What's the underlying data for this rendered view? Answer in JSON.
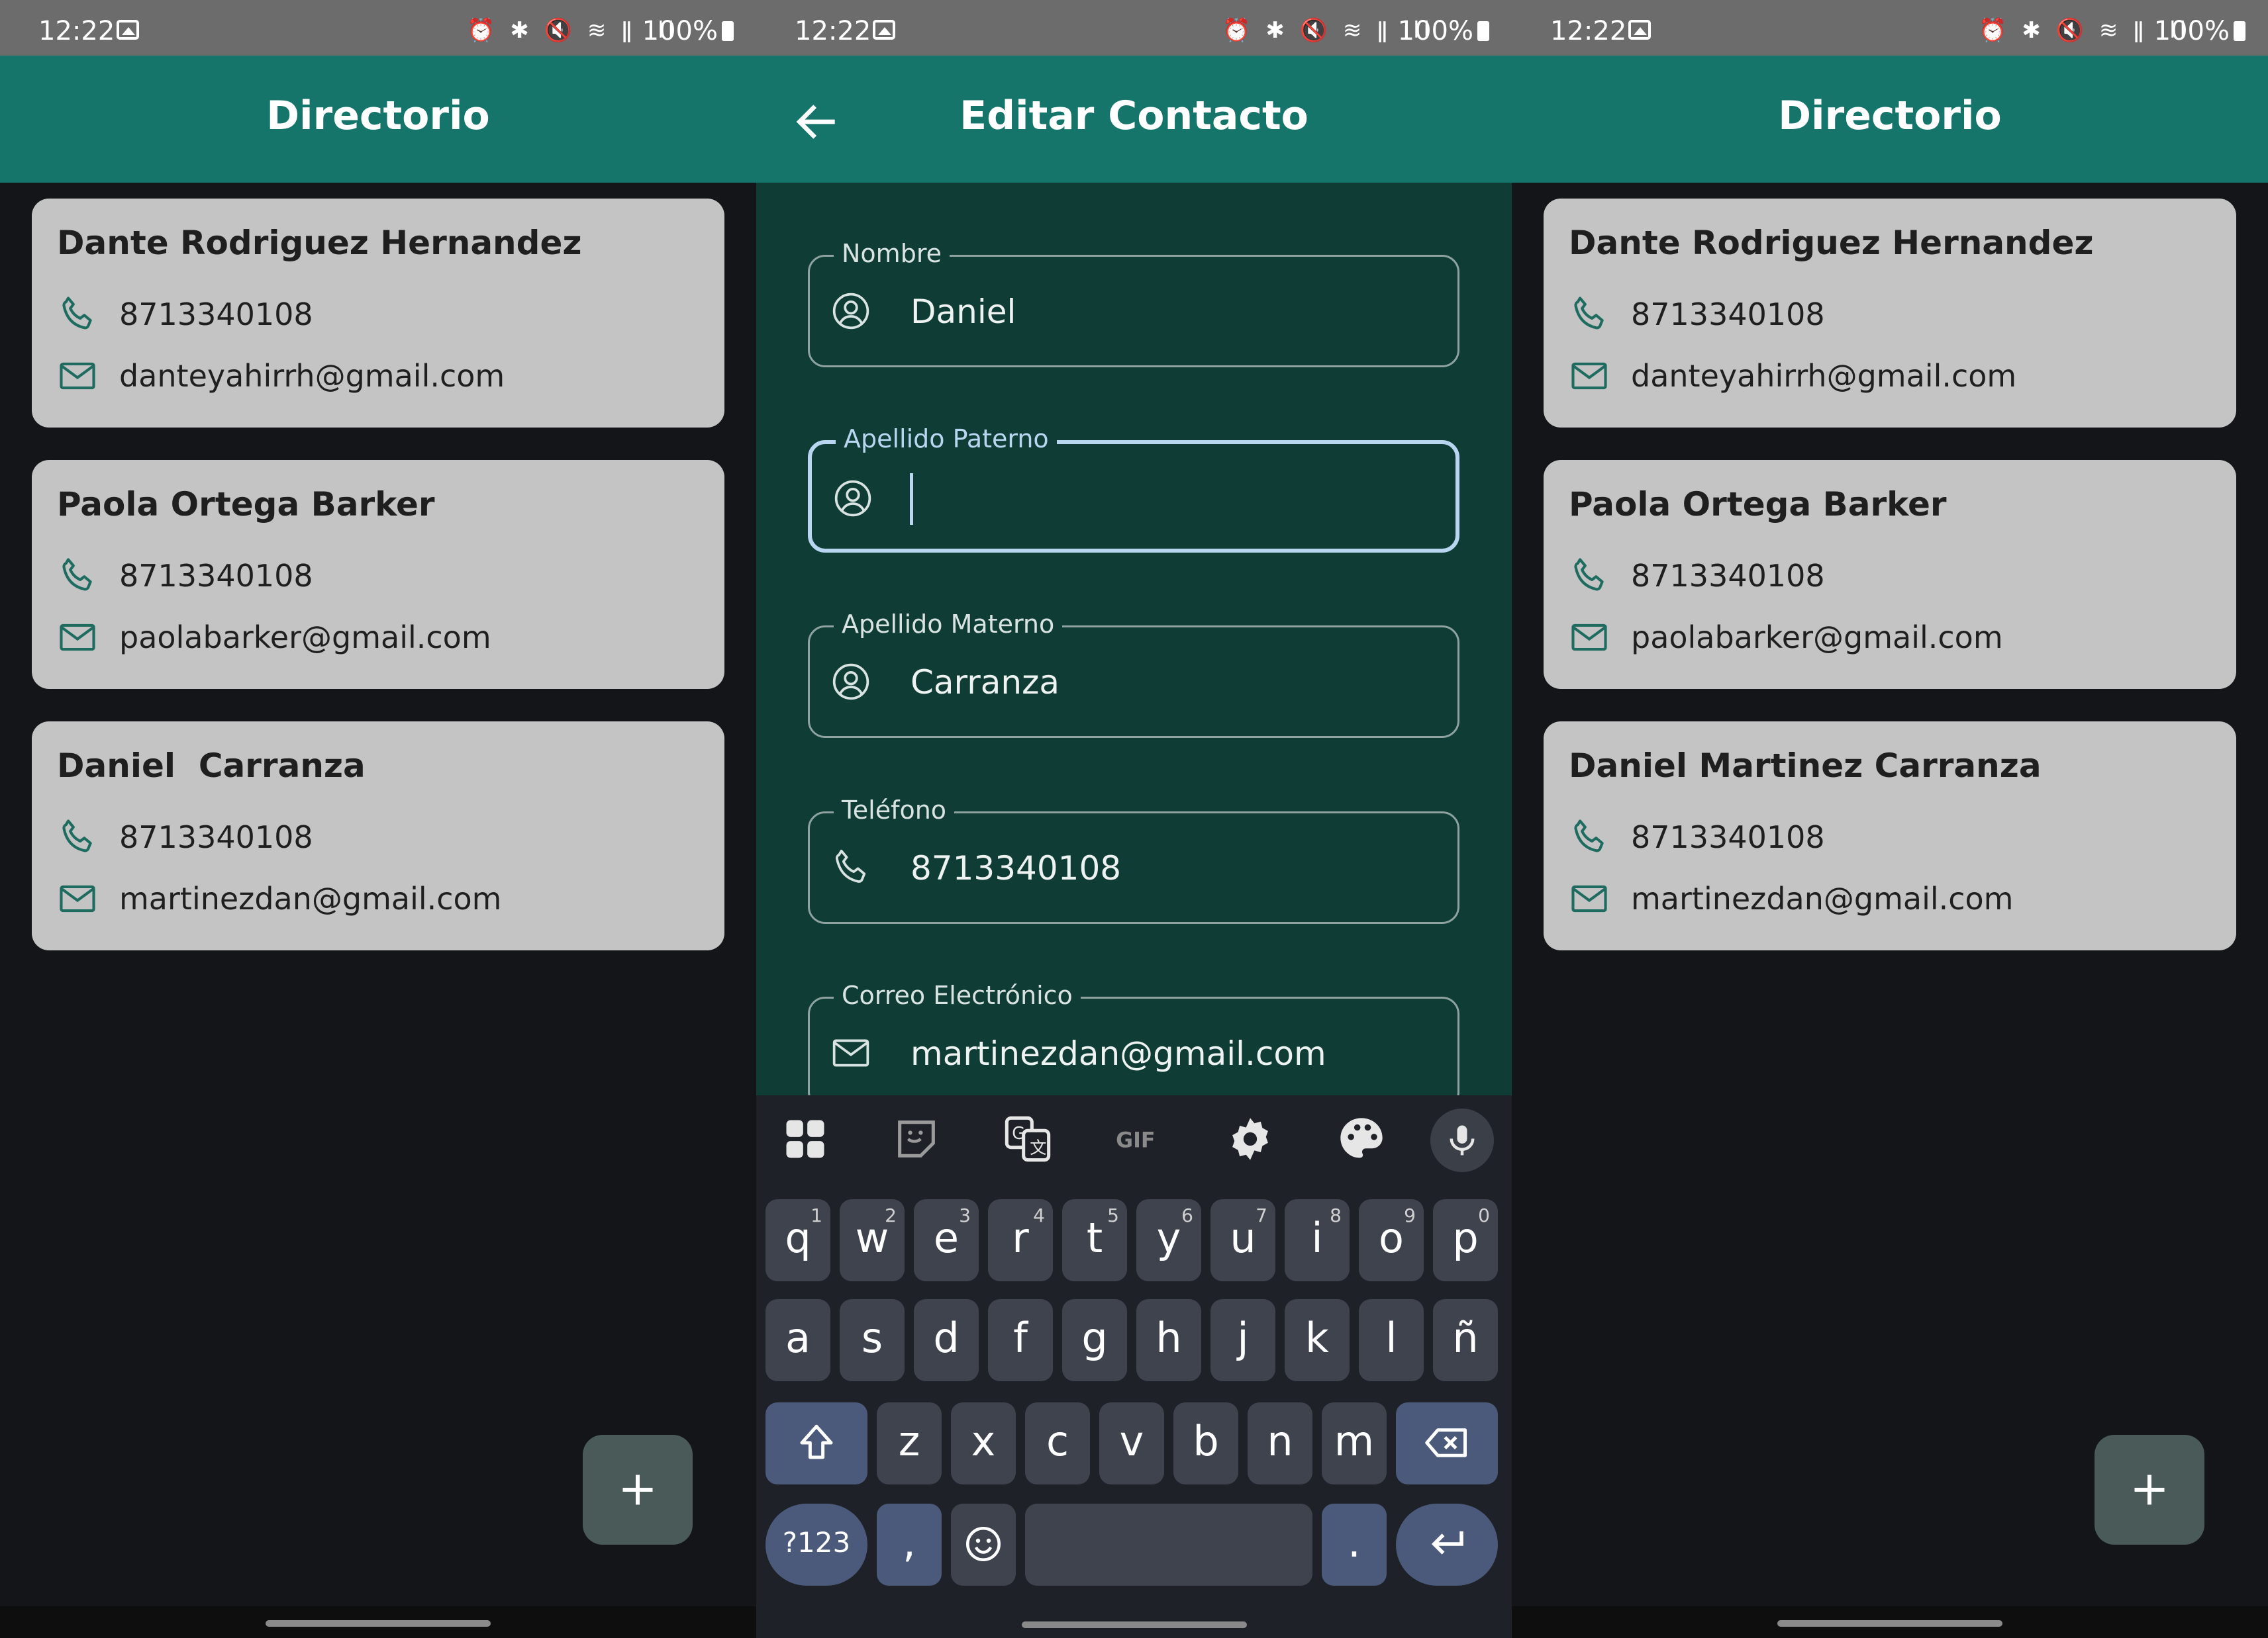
{
  "status_bar": {
    "time": "12:22",
    "battery": "100%",
    "icons": "⏰ ✱ 🔇 ≋ ǁ ıll"
  },
  "screen1": {
    "title": "Directorio",
    "contacts": [
      {
        "name": "Dante Rodriguez Hernandez",
        "phone": "8713340108",
        "email": "danteyahirrh@gmail.com"
      },
      {
        "name": "Paola Ortega Barker",
        "phone": "8713340108",
        "email": "paolabarker@gmail.com"
      },
      {
        "name": "Daniel  Carranza",
        "phone": "8713340108",
        "email": "martinezdan@gmail.com"
      }
    ]
  },
  "screen2": {
    "title": "Editar Contacto",
    "fields": [
      {
        "label": "Nombre",
        "value": "Daniel",
        "icon": "person-icon"
      },
      {
        "label": "Apellido Paterno",
        "value": "",
        "icon": "person-icon"
      },
      {
        "label": "Apellido Materno",
        "value": "Carranza",
        "icon": "person-icon"
      },
      {
        "label": "Teléfono",
        "value": "8713340108",
        "icon": "phone-icon"
      },
      {
        "label": "Correo Electrónico",
        "value": "martinezdan@gmail.com",
        "icon": "mail-icon"
      }
    ],
    "keyboard": {
      "row1": [
        "q",
        "w",
        "e",
        "r",
        "t",
        "y",
        "u",
        "i",
        "o",
        "p"
      ],
      "row1_sup": [
        "1",
        "2",
        "3",
        "4",
        "5",
        "6",
        "7",
        "8",
        "9",
        "0"
      ],
      "row2": [
        "a",
        "s",
        "d",
        "f",
        "g",
        "h",
        "j",
        "k",
        "l",
        "ñ"
      ],
      "row3": [
        "z",
        "x",
        "c",
        "v",
        "b",
        "n",
        "m"
      ],
      "symbols": "?123",
      "comma": ",",
      "period": ".",
      "gif": "GIF"
    }
  },
  "screen3": {
    "title": "Directorio",
    "contacts": [
      {
        "name": "Dante Rodriguez Hernandez",
        "phone": "8713340108",
        "email": "danteyahirrh@gmail.com"
      },
      {
        "name": "Paola Ortega Barker",
        "phone": "8713340108",
        "email": "paolabarker@gmail.com"
      },
      {
        "name": "Daniel Martinez Carranza",
        "phone": "8713340108",
        "email": "martinezdan@gmail.com"
      }
    ]
  },
  "colors": {
    "app_bar": "#16756a",
    "card": "#c4c4c4",
    "form_bg": "#0f3d36",
    "focus": "#b8d6f0",
    "icon_accent": "#1e6b5f"
  }
}
